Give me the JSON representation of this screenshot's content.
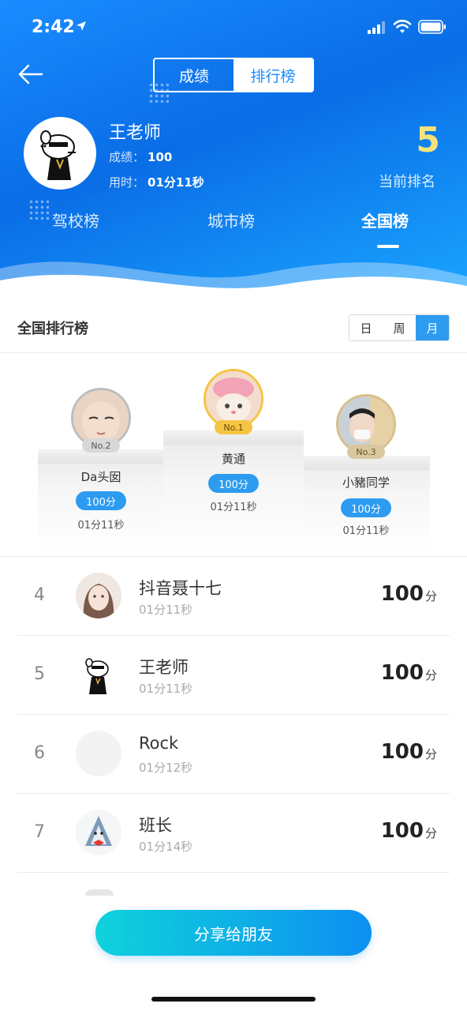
{
  "status": {
    "time": "2:42"
  },
  "header": {
    "segments": [
      "成绩",
      "排行榜"
    ],
    "active_segment": 1,
    "user": {
      "name": "王老师",
      "score_label": "成绩：",
      "score_value": "100",
      "time_label": "用时：",
      "time_value": "01分11秒"
    },
    "rank": {
      "value": "5",
      "label": "当前排名"
    },
    "tabs": [
      "驾校榜",
      "城市榜",
      "全国榜"
    ],
    "active_tab": 2
  },
  "section": {
    "title": "全国排行榜",
    "periods": [
      "日",
      "周",
      "月"
    ],
    "active_period": 2
  },
  "podium": {
    "first": {
      "badge": "No.1",
      "name": "黄通",
      "score": "100分",
      "time": "01分11秒"
    },
    "second": {
      "badge": "No.2",
      "name": "Da头囡",
      "score": "100分",
      "time": "01分11秒"
    },
    "third": {
      "badge": "No.3",
      "name": "小豬同学",
      "score": "100分",
      "time": "01分11秒"
    }
  },
  "list": [
    {
      "rank": "4",
      "name": "抖音聂十七",
      "time": "01分11秒",
      "score": "100",
      "unit": "分"
    },
    {
      "rank": "5",
      "name": "王老师",
      "time": "01分11秒",
      "score": "100",
      "unit": "分"
    },
    {
      "rank": "6",
      "name": "Rock",
      "time": "01分12秒",
      "score": "100",
      "unit": "分"
    },
    {
      "rank": "7",
      "name": "班长",
      "time": "01分14秒",
      "score": "100",
      "unit": "分"
    }
  ],
  "share_button": "分享给朋友",
  "colors": {
    "header_blue": "#0a6de6",
    "accent_blue": "#2d9bf0",
    "rank_yellow": "#f6e27a",
    "gold_badge": "#f5c443"
  }
}
